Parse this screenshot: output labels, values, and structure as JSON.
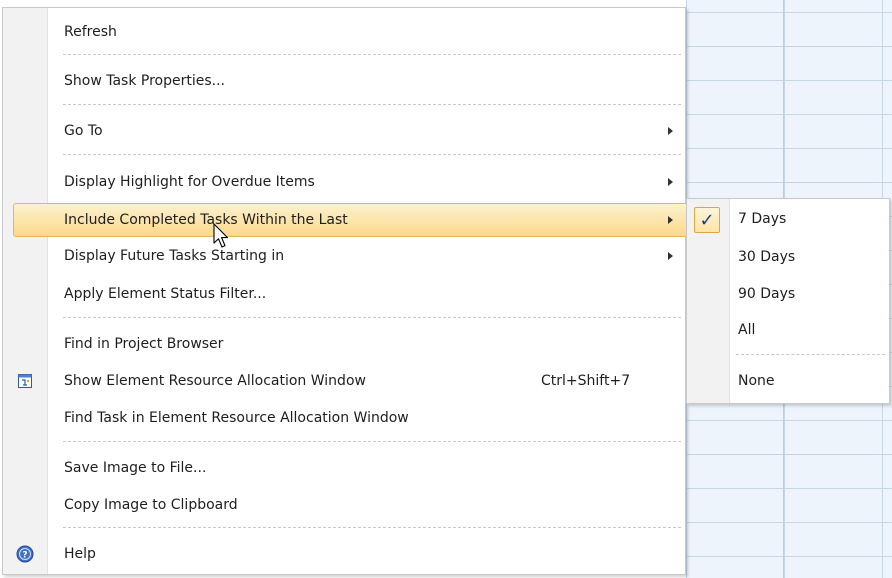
{
  "menu": {
    "items": [
      {
        "label": "Refresh"
      },
      {
        "label": "Show Task Properties..."
      },
      {
        "label": "Go To",
        "submenu": true
      },
      {
        "label": "Display Highlight for Overdue Items",
        "submenu": true
      },
      {
        "label": "Include Completed Tasks Within the Last",
        "submenu": true,
        "highlighted": true
      },
      {
        "label": "Display Future Tasks Starting in",
        "submenu": true
      },
      {
        "label": "Apply Element Status Filter..."
      },
      {
        "label": "Find in Project Browser"
      },
      {
        "label": "Show Element Resource Allocation Window",
        "shortcut": "Ctrl+Shift+7",
        "icon": "resource-window-icon"
      },
      {
        "label": "Find Task in Element Resource Allocation Window"
      },
      {
        "label": "Save Image to File..."
      },
      {
        "label": "Copy Image to Clipboard"
      },
      {
        "label": "Help",
        "icon": "help-icon"
      }
    ]
  },
  "submenu": {
    "items": [
      {
        "label": "7 Days",
        "checked": true
      },
      {
        "label": "30 Days"
      },
      {
        "label": "90 Days"
      },
      {
        "label": "All"
      },
      {
        "label": "None"
      }
    ],
    "check_glyph": "✓"
  },
  "colors": {
    "highlight_top": "#fdf1cf",
    "highlight_bottom": "#fbd98a",
    "highlight_border": "#e9b752",
    "grid_background": "#eef4fb",
    "grid_line": "#c5d6ea"
  }
}
